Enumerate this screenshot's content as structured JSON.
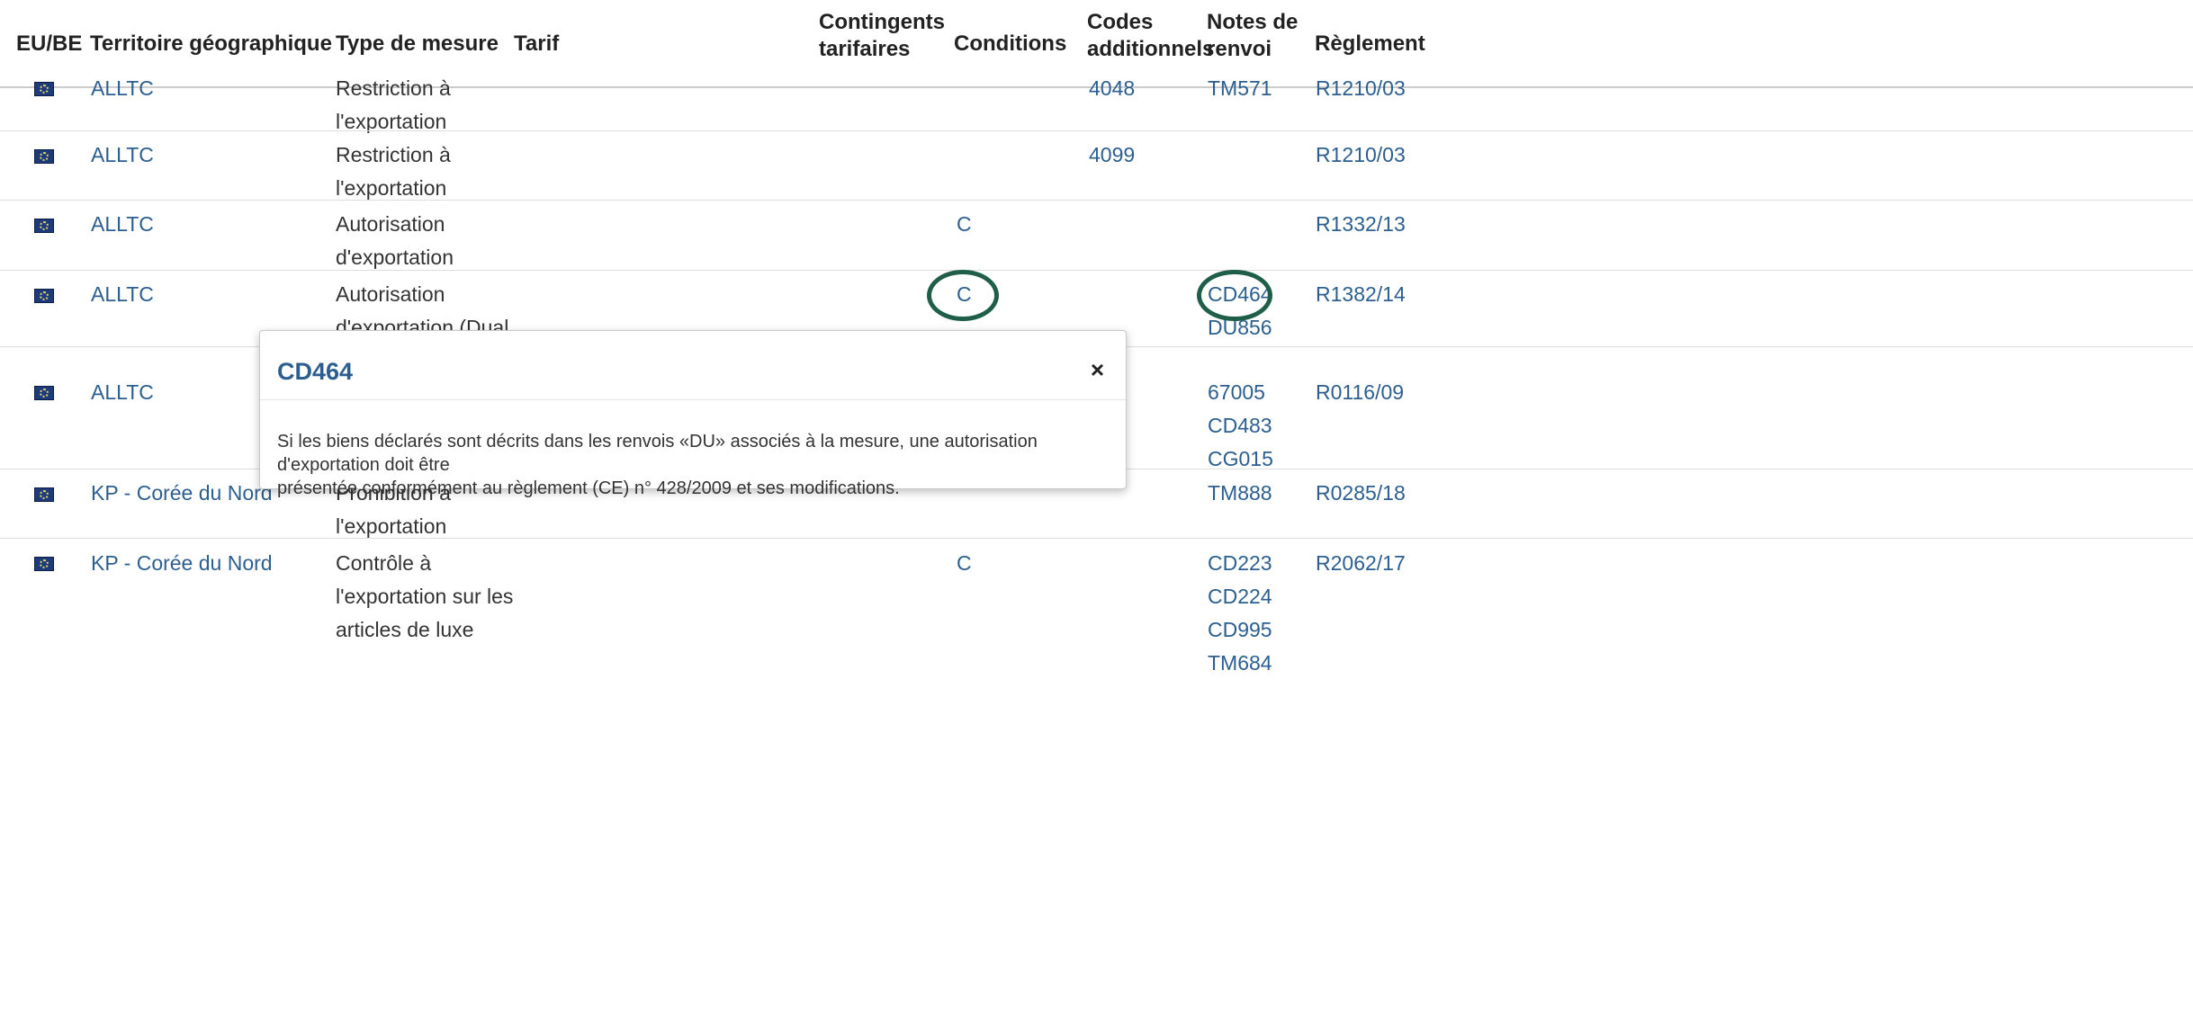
{
  "headers": {
    "eu_be": "EU/BE",
    "territoire": "Territoire géographique",
    "type_mesure": "Type de mesure",
    "tarif": "Tarif",
    "contingents_1": "Contingents",
    "contingents_2": "tarifaires",
    "conditions": "Conditions",
    "codes_1": "Codes",
    "codes_2": "additionnels",
    "notes_1": "Notes de",
    "notes_2": "renvoi",
    "reglement": "Règlement"
  },
  "rows": [
    {
      "territoire": "ALLTC",
      "type_mesure": [
        "Restriction à",
        "l'exportation"
      ],
      "conditions": "",
      "codes": "4048",
      "notes": [
        "TM571"
      ],
      "reglement": "R1210/03"
    },
    {
      "territoire": "ALLTC",
      "type_mesure": [
        "Restriction à",
        "l'exportation"
      ],
      "conditions": "",
      "codes": "4099",
      "notes": [],
      "reglement": "R1210/03"
    },
    {
      "territoire": "ALLTC",
      "type_mesure": [
        "Autorisation",
        "d'exportation"
      ],
      "conditions": "C",
      "codes": "",
      "notes": [],
      "reglement": "R1332/13"
    },
    {
      "territoire": "ALLTC",
      "type_mesure": [
        "Autorisation",
        "d'exportation (Dual"
      ],
      "conditions": "C",
      "codes": "",
      "notes": [
        "CD464",
        "DU856"
      ],
      "reglement": "R1382/14"
    },
    {
      "territoire": "ALLTC",
      "type_mesure": [],
      "conditions": "",
      "codes": "",
      "notes": [
        "67005",
        "CD483",
        "CG015"
      ],
      "reglement": "R0116/09"
    },
    {
      "territoire": "KP - Corée du Nord",
      "type_mesure": [
        "Prohibition à",
        "l'exportation"
      ],
      "conditions": "",
      "codes": "",
      "notes": [
        "TM888"
      ],
      "reglement": "R0285/18"
    },
    {
      "territoire": "KP - Corée du Nord",
      "type_mesure": [
        "Contrôle à",
        "l'exportation sur les",
        "articles de luxe"
      ],
      "conditions": "C",
      "codes": "",
      "notes": [
        "CD223",
        "CD224",
        "CD995",
        "TM684"
      ],
      "reglement": "R2062/17"
    }
  ],
  "modal": {
    "title": "CD464",
    "close_icon": "×",
    "body_line1": "Si les biens déclarés sont décrits dans les renvois «DU» associés à la mesure, une autorisation d'exportation doit être",
    "body_line2": "présentée conformément au règlement (CE) n° 428/2009 et ses modifications."
  },
  "colors": {
    "link": "#2c5f8f",
    "highlight_circle": "#1f5e48"
  }
}
